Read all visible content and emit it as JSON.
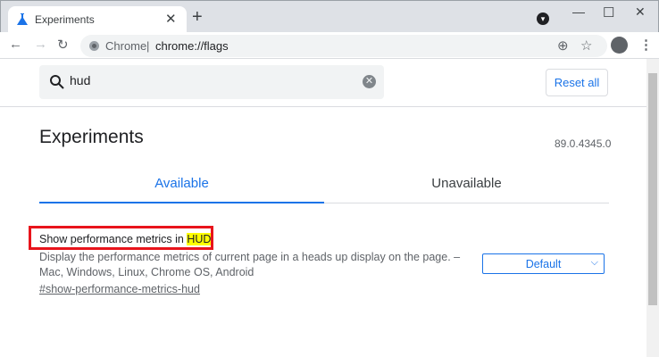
{
  "tab": {
    "title": "Experiments",
    "close": "✕",
    "new_tab": "+"
  },
  "window": {
    "minimize": "—",
    "maximize": "☐",
    "close": "✕",
    "profile_menu": "▾"
  },
  "toolbar": {
    "back": "←",
    "forward": "→",
    "reload": "↻",
    "site_label": "Chrome",
    "separator": "|",
    "url": "chrome://flags",
    "zoom": "⊕",
    "star": "☆",
    "menu": "⋮"
  },
  "search": {
    "value": "hud",
    "clear": "✕"
  },
  "reset_label": "Reset all",
  "page_title": "Experiments",
  "version": "89.0.4345.0",
  "tabs": [
    {
      "label": "Available"
    },
    {
      "label": "Unavailable"
    }
  ],
  "flag": {
    "name_prefix": "Show performance metrics in ",
    "name_highlight": "HUD",
    "description": "Display the performance metrics of current page in a heads up display on the page. – Mac, Windows, Linux, Chrome OS, Android",
    "link": "#show-performance-metrics-hud",
    "select_value": "Default"
  },
  "colors": {
    "accent": "#1a73e8",
    "highlight": "#ffff00",
    "annotation": "#e8141c"
  }
}
